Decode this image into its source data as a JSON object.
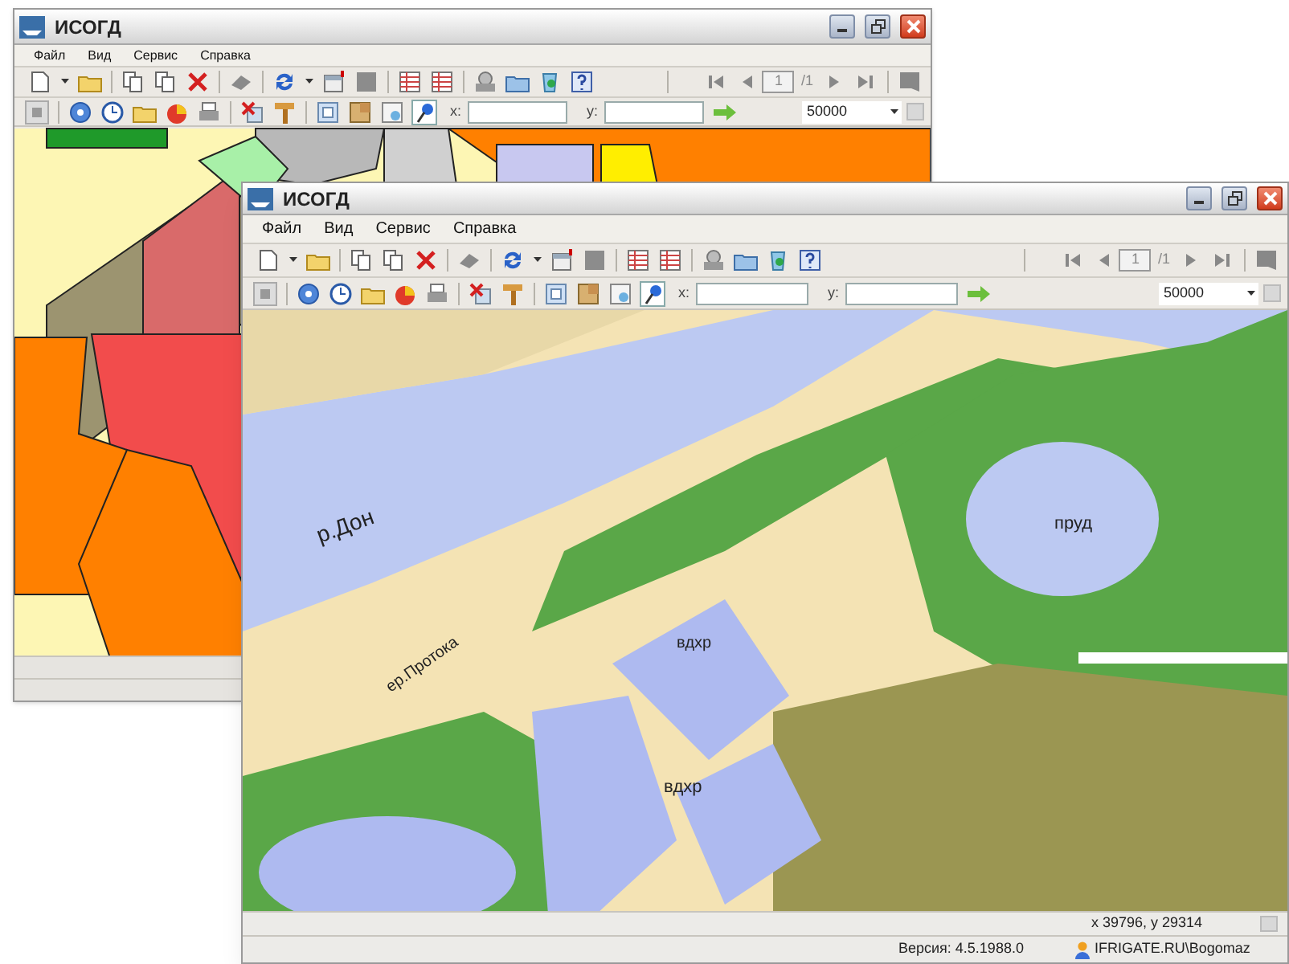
{
  "back_window": {
    "title": "ИСОГД",
    "menu": [
      "Файл",
      "Вид",
      "Сервис",
      "Справка"
    ],
    "page_current": "1",
    "page_total": "/1",
    "x_label": "x:",
    "y_label": "y:",
    "scale": "50000"
  },
  "front_window": {
    "title": "ИСОГД",
    "menu": [
      "Файл",
      "Вид",
      "Сервис",
      "Справка"
    ],
    "page_current": "1",
    "page_total": "/1",
    "x_label": "x:",
    "y_label": "y:",
    "scale": "50000",
    "map_labels": [
      "р.Дон",
      "ер.Протока",
      "вдхр",
      "вдхр",
      "пруд"
    ],
    "coordinates": "x 39796, y 29314",
    "version": "Версия: 4.5.1988.0",
    "user": "IFRIGATE.RU\\Bogomaz"
  }
}
